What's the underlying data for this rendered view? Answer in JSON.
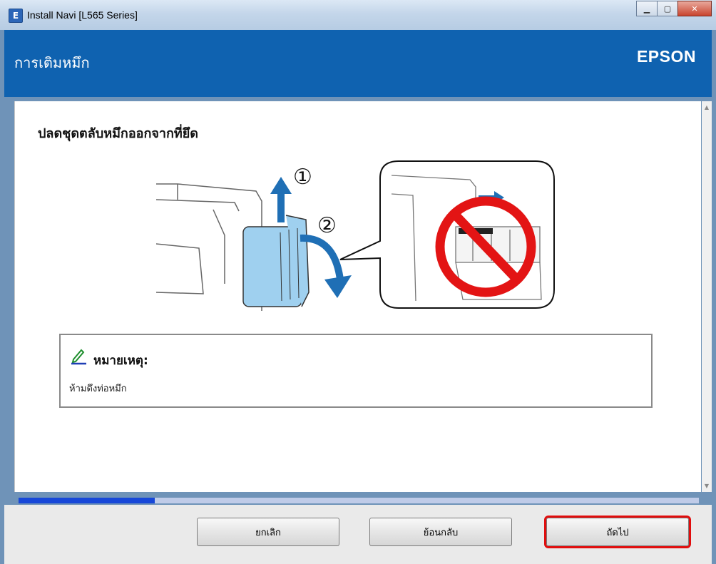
{
  "window": {
    "title": "Install Navi [L565 Series]",
    "icon_letter": "E"
  },
  "header": {
    "title": "การเติมหมึก",
    "brand": "EPSON"
  },
  "content": {
    "heading": "ปลดชุดตลับหมึกออกจากที่ยึด",
    "step_labels": [
      "①",
      "②"
    ],
    "note": {
      "title": "หมายเหตุ:",
      "body": "ห้ามดึงท่อหมึก",
      "icon": "pencil-icon"
    }
  },
  "progress": {
    "value_percent": 20
  },
  "footer": {
    "cancel_label": "ยกเลิก",
    "back_label": "ย้อนกลับ",
    "next_label": "ถัดไป"
  },
  "colors": {
    "header_bg": "#0f62b0",
    "progress_fill": "#1747d8",
    "highlight": "#e10d0d",
    "prohibit": "#e31414",
    "ink_tank": "#9fd0ef"
  }
}
